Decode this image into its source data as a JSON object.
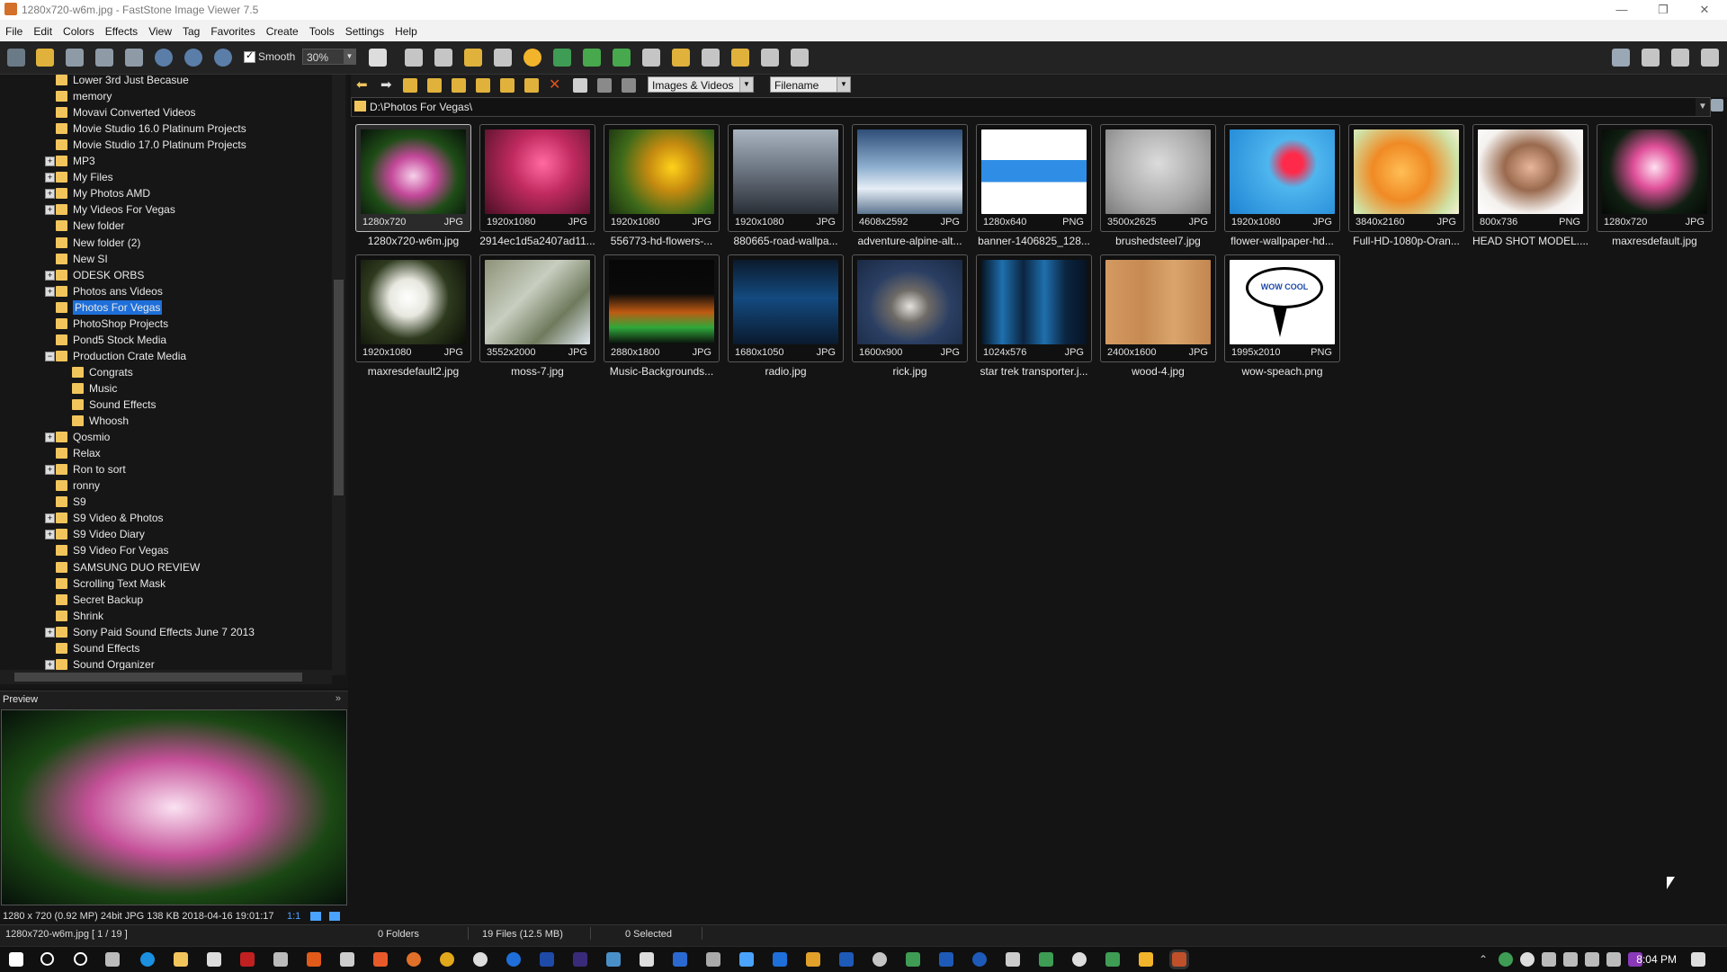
{
  "window": {
    "title": "1280x720-w6m.jpg - FastStone Image Viewer 7.5",
    "minimize": "—",
    "restore": "❐",
    "close": "✕"
  },
  "menu": [
    "File",
    "Edit",
    "Colors",
    "Effects",
    "View",
    "Tag",
    "Favorites",
    "Create",
    "Tools",
    "Settings",
    "Help"
  ],
  "toolbar": {
    "smooth_label": "Smooth",
    "smooth_checked": true,
    "zoom_value": "30%"
  },
  "tree": {
    "items": [
      {
        "label": "Lower 3rd Just Becasue",
        "expander": ""
      },
      {
        "label": "memory",
        "expander": ""
      },
      {
        "label": "Movavi Converted Videos",
        "expander": ""
      },
      {
        "label": "Movie Studio 16.0 Platinum Projects",
        "expander": ""
      },
      {
        "label": "Movie Studio 17.0 Platinum Projects",
        "expander": ""
      },
      {
        "label": "MP3",
        "expander": "+"
      },
      {
        "label": "My Files",
        "expander": "+"
      },
      {
        "label": "My Photos AMD",
        "expander": "+"
      },
      {
        "label": "My Videos For Vegas",
        "expander": "+"
      },
      {
        "label": "New folder",
        "expander": ""
      },
      {
        "label": "New folder (2)",
        "expander": ""
      },
      {
        "label": "New SI",
        "expander": ""
      },
      {
        "label": "ODESK ORBS",
        "expander": "+"
      },
      {
        "label": "Photos ans Videos",
        "expander": "+"
      },
      {
        "label": "Photos For Vegas",
        "expander": "",
        "selected": true
      },
      {
        "label": "PhotoShop Projects",
        "expander": ""
      },
      {
        "label": "Pond5 Stock Media",
        "expander": ""
      },
      {
        "label": "Production Crate Media",
        "expander": "−"
      },
      {
        "label": "Congrats",
        "expander": "",
        "child": true
      },
      {
        "label": "Music",
        "expander": "",
        "child": true
      },
      {
        "label": "Sound Effects",
        "expander": "",
        "child": true
      },
      {
        "label": "Whoosh",
        "expander": "",
        "child": true
      },
      {
        "label": "Qosmio",
        "expander": "+"
      },
      {
        "label": "Relax",
        "expander": ""
      },
      {
        "label": "Ron to sort",
        "expander": "+"
      },
      {
        "label": "ronny",
        "expander": ""
      },
      {
        "label": "S9",
        "expander": ""
      },
      {
        "label": "S9 Video & Photos",
        "expander": "+"
      },
      {
        "label": "S9 Video Diary",
        "expander": "+"
      },
      {
        "label": "S9 Video For Vegas",
        "expander": ""
      },
      {
        "label": "SAMSUNG DUO REVIEW",
        "expander": ""
      },
      {
        "label": "Scrolling Text Mask",
        "expander": ""
      },
      {
        "label": "Secret Backup",
        "expander": ""
      },
      {
        "label": "Shrink",
        "expander": ""
      },
      {
        "label": "Sony Paid Sound Effects June 7 2013",
        "expander": "+"
      },
      {
        "label": "Sound Effects",
        "expander": ""
      },
      {
        "label": "Sound Organizer",
        "expander": "+"
      }
    ]
  },
  "preview": {
    "header": "Preview",
    "collapse_glyph": "»",
    "info": "1280 x 720 (0.92 MP)  24bit  JPG   138 KB   2018-04-16 19:01:17",
    "ratio": "1:1"
  },
  "nav": {
    "filter": "Images & Videos",
    "sort": "Filename",
    "path": "D:\\Photos For Vegas\\"
  },
  "thumbnails": [
    {
      "res": "1280x720",
      "fmt": "JPG",
      "name": "1280x720-w6m.jpg",
      "selected": true,
      "bg": "radial-gradient(ellipse at 50% 55%, #f6d0ea 0%, #c4489a 30%, #1f4d17 60%, #07120a 100%)"
    },
    {
      "res": "1920x1080",
      "fmt": "JPG",
      "name": "2914ec1d5a2407ad11...",
      "bg": "radial-gradient(circle at 55% 40%, #ff6aa0 0%, #c02a5f 40%, #4a0f25 100%)"
    },
    {
      "res": "1920x1080",
      "fmt": "JPG",
      "name": "556773-hd-flowers-...",
      "bg": "radial-gradient(circle at 60% 45%, #ffd21a 0%, #c68b10 30%, #3e6a1a 65%, #1b3010 100%)"
    },
    {
      "res": "1920x1080",
      "fmt": "JPG",
      "name": "880665-road-wallpa...",
      "bg": "linear-gradient(180deg, #aab4c0 0%, #6f7885 45%, #2a2f36 100%)"
    },
    {
      "res": "4608x2592",
      "fmt": "JPG",
      "name": "adventure-alpine-alt...",
      "bg": "linear-gradient(180deg, #2f4e78 0%, #8fb0d0 45%, #e6eef6 70%, #5d7590 100%)"
    },
    {
      "res": "1280x640",
      "fmt": "PNG",
      "name": "banner-1406825_128...",
      "bg": "linear-gradient(180deg, #ffffff 0%, #ffffff 36%, #2f8de6 36%, #2f8de6 62%, #ffffff 62%, #ffffff 100%)"
    },
    {
      "res": "3500x2625",
      "fmt": "JPG",
      "name": "brushedsteel7.jpg",
      "bg": "radial-gradient(ellipse at 50% 40%, #dcdcdc 0%, #a8a8a8 60%, #7a7a7a 100%)"
    },
    {
      "res": "1920x1080",
      "fmt": "JPG",
      "name": "flower-wallpaper-hd...",
      "bg": "radial-gradient(circle at 60% 40%, #ff2a4a 0%, #ff2a4a 12%, #4fb6ee 30%, #1e84d4 100%)"
    },
    {
      "res": "3840x2160",
      "fmt": "JPG",
      "name": "Full-HD-1080p-Oran...",
      "bg": "radial-gradient(circle at 45% 50%, #ffbe55 0%, #f08a24 40%, #cfe3a8 80%, #f7f1d8 100%)"
    },
    {
      "res": "800x736",
      "fmt": "PNG",
      "name": "HEAD SHOT MODEL....",
      "bg": "radial-gradient(ellipse at 50% 45%, #e8b79a 0%, #9a6a4e 35%, #f4f1ee 70%, #ffffff 100%)"
    },
    {
      "res": "1280x720",
      "fmt": "JPG",
      "name": "maxresdefault.jpg",
      "bg": "radial-gradient(circle at 50% 45%, #ffe0f0 0%, #e0509a 30%, #102012 65%, #050805 100%)"
    },
    {
      "res": "1920x1080",
      "fmt": "JPG",
      "name": "maxresdefault2.jpg",
      "bg": "radial-gradient(circle at 45% 45%, #ffffff 0%, #e8e8e0 25%, #2e3a1e 55%, #0a0d06 100%)"
    },
    {
      "res": "3552x2000",
      "fmt": "JPG",
      "name": "moss-7.jpg",
      "bg": "linear-gradient(135deg, #8d9378 0%, #c8cec0 40%, #6f7a5d 70%, #e0e8f0 100%)"
    },
    {
      "res": "2880x1800",
      "fmt": "JPG",
      "name": "Music-Backgrounds...",
      "bg": "linear-gradient(180deg, #070707 0%, #0a0a0a 40%, #c05a12 62%, #2fa83a 80%, #0a0a0a 100%)"
    },
    {
      "res": "1680x1050",
      "fmt": "JPG",
      "name": "radio.jpg",
      "bg": "linear-gradient(180deg, #0b1a2c 0%, #134a80 45%, #0a1a2e 100%)"
    },
    {
      "res": "1600x900",
      "fmt": "JPG",
      "name": "rick.jpg",
      "bg": "radial-gradient(ellipse at 50% 55%, #e5e2dc 0%, #6e6a66 25%, #2b3f63 55%, #1a2a44 100%)"
    },
    {
      "res": "1024x576",
      "fmt": "JPG",
      "name": "star trek transporter.j...",
      "bg": "linear-gradient(90deg, #061424 0%, #1f6fae 20%, #0b2540 40%, #1f6fae 60%, #0b2540 80%, #061424 100%)"
    },
    {
      "res": "2400x1600",
      "fmt": "JPG",
      "name": "wood-4.jpg",
      "bg": "linear-gradient(90deg, #d49a62 0%, #c68a52 35%, #d9a56c 65%, #c38650 100%)"
    },
    {
      "res": "1995x2010",
      "fmt": "PNG",
      "name": "wow-speach.png",
      "bg": "#ffffff",
      "wow": "WOW COOL"
    }
  ],
  "status": {
    "folders": "0 Folders",
    "files": "19 Files (12.5 MB)",
    "selected": "0 Selected",
    "current_file": "1280x720-w6m.jpg [ 1 / 19 ]"
  },
  "taskbar": {
    "time": "8:04 PM"
  }
}
